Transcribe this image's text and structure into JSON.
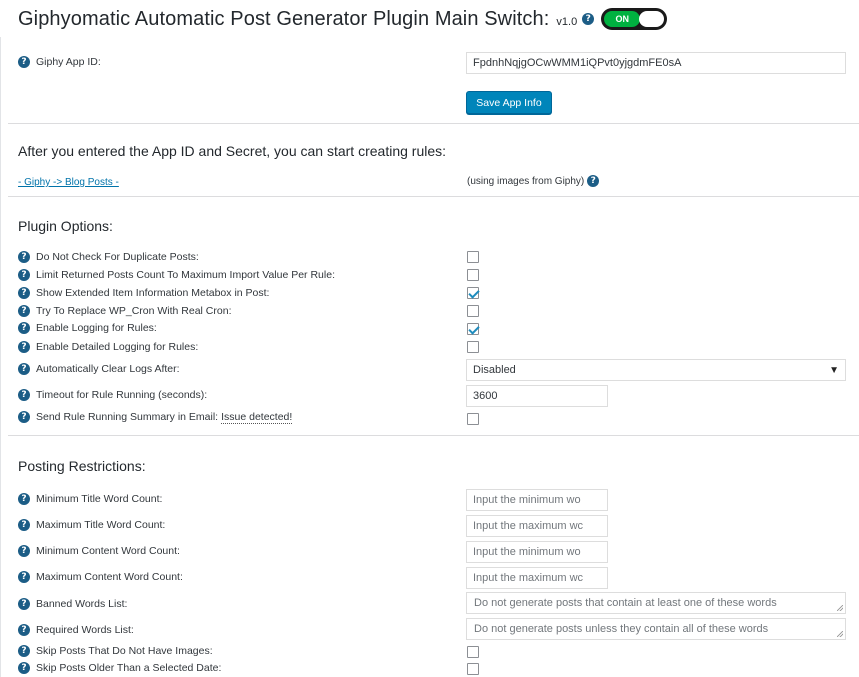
{
  "header": {
    "title": "Giphyomatic Automatic Post Generator Plugin Main Switch:",
    "version": "v1.0",
    "toggle_label": "ON"
  },
  "app_id": {
    "label": "Giphy App ID:",
    "value": "FpdnhNqjgOCwWMM1iQPvt0yjgdmFE0sA",
    "save_label": "Save App Info"
  },
  "rules_section": {
    "title": "After you entered the App ID and Secret, you can start creating rules:",
    "link_text": "- Giphy -> Blog Posts -",
    "link_desc": "(using images from Giphy)"
  },
  "plugin_options": {
    "title": "Plugin Options:",
    "options": [
      {
        "label": "Do Not Check For Duplicate Posts:",
        "checked": false
      },
      {
        "label": "Limit Returned Posts Count To Maximum Import Value Per Rule:",
        "checked": false
      },
      {
        "label": "Show Extended Item Information Metabox in Post:",
        "checked": true
      },
      {
        "label": "Try To Replace WP_Cron With Real Cron:",
        "checked": false
      },
      {
        "label": "Enable Logging for Rules:",
        "checked": true
      },
      {
        "label": "Enable Detailed Logging for Rules:",
        "checked": false
      }
    ],
    "clear_logs": {
      "label": "Automatically Clear Logs After:",
      "value": "Disabled"
    },
    "timeout": {
      "label": "Timeout for Rule Running (seconds):",
      "value": "3600"
    },
    "email_summary": {
      "label": "Send Rule Running Summary in Email:",
      "issue": "Issue detected!",
      "checked": false
    }
  },
  "posting_restrictions": {
    "title": "Posting Restrictions:",
    "fields": [
      {
        "label": "Minimum Title Word Count:",
        "placeholder": "Input the minimum wo"
      },
      {
        "label": "Maximum Title Word Count:",
        "placeholder": "Input the maximum wc"
      },
      {
        "label": "Minimum Content Word Count:",
        "placeholder": "Input the minimum wo"
      },
      {
        "label": "Maximum Content Word Count:",
        "placeholder": "Input the maximum wc"
      }
    ],
    "banned": {
      "label": "Banned Words List:",
      "placeholder": "Do not generate posts that contain at least one of these words"
    },
    "required": {
      "label": "Required Words List:",
      "placeholder": "Do not generate posts unless they contain all of these words"
    },
    "skip_images": {
      "label": "Skip Posts That Do Not Have Images:",
      "checked": false
    },
    "skip_older": {
      "label": "Skip Posts Older Than a Selected Date:",
      "checked": false
    }
  },
  "icons": {
    "help": "help-circle-icon",
    "select_caret": "caret-down-icon"
  },
  "colors": {
    "accent": "#0085ba",
    "toggle_on": "#00b140",
    "help_icon": "#1c5d86",
    "check": "#1e8cbe"
  }
}
